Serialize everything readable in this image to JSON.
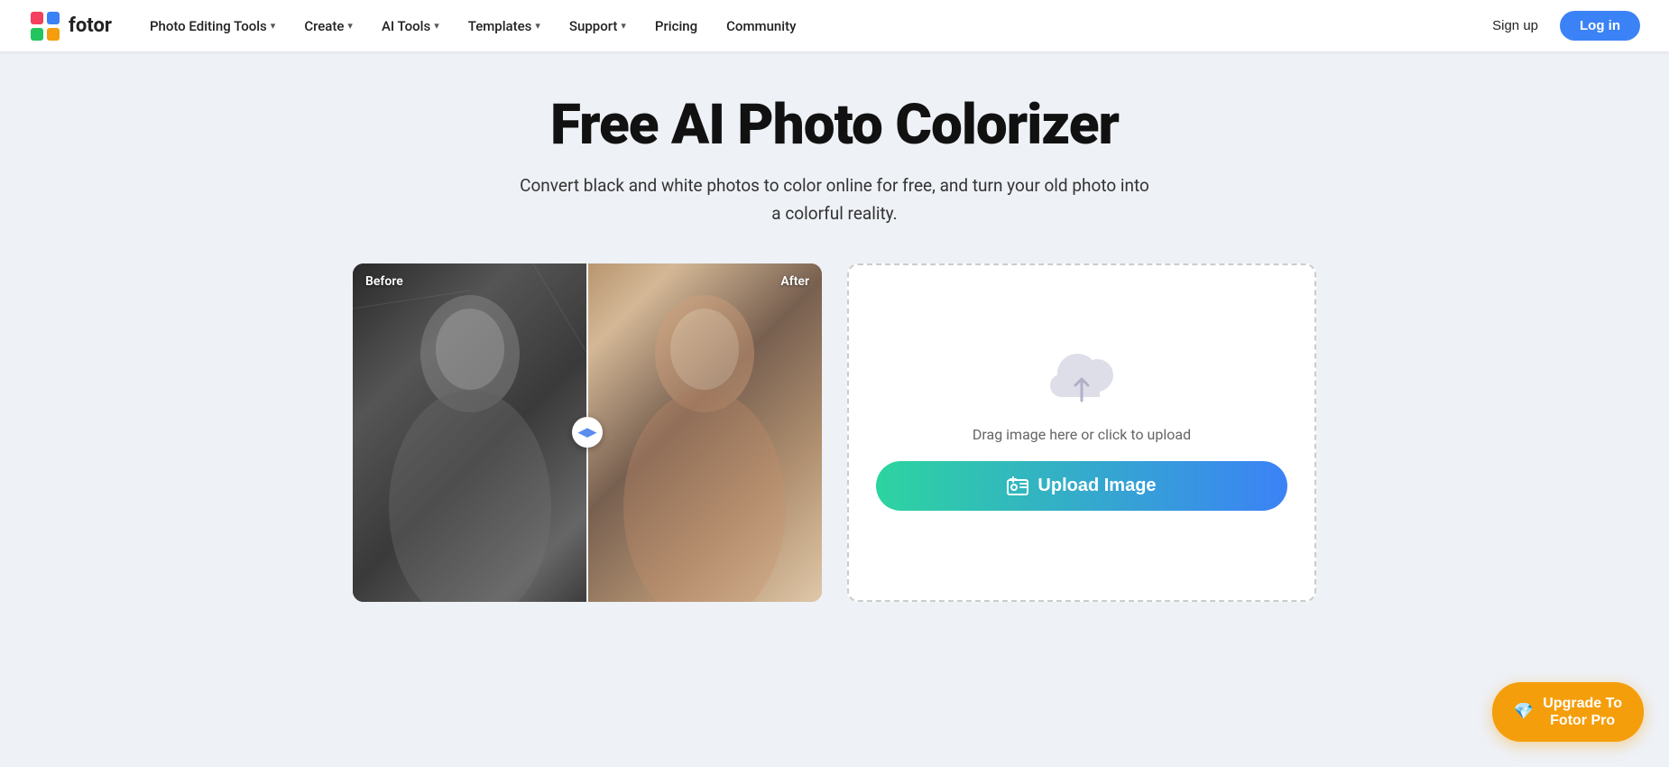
{
  "brand": {
    "name": "fotor",
    "logo_alt": "Fotor logo"
  },
  "nav": {
    "items": [
      {
        "label": "Photo Editing Tools",
        "has_dropdown": true
      },
      {
        "label": "Create",
        "has_dropdown": true
      },
      {
        "label": "AI Tools",
        "has_dropdown": true
      },
      {
        "label": "Templates",
        "has_dropdown": true
      },
      {
        "label": "Support",
        "has_dropdown": true
      },
      {
        "label": "Pricing",
        "has_dropdown": false
      },
      {
        "label": "Community",
        "has_dropdown": false
      }
    ],
    "signup_label": "Sign up",
    "login_label": "Log in"
  },
  "page": {
    "title": "Free AI Photo Colorizer",
    "subtitle": "Convert black and white photos to color online for free, and turn your old photo into a colorful reality.",
    "before_label": "Before",
    "after_label": "After",
    "upload_hint": "Drag image here or click to upload",
    "upload_button_label": "Upload Image"
  },
  "upgrade": {
    "line1": "Upgrade To",
    "line2": "Fotor Pro"
  }
}
